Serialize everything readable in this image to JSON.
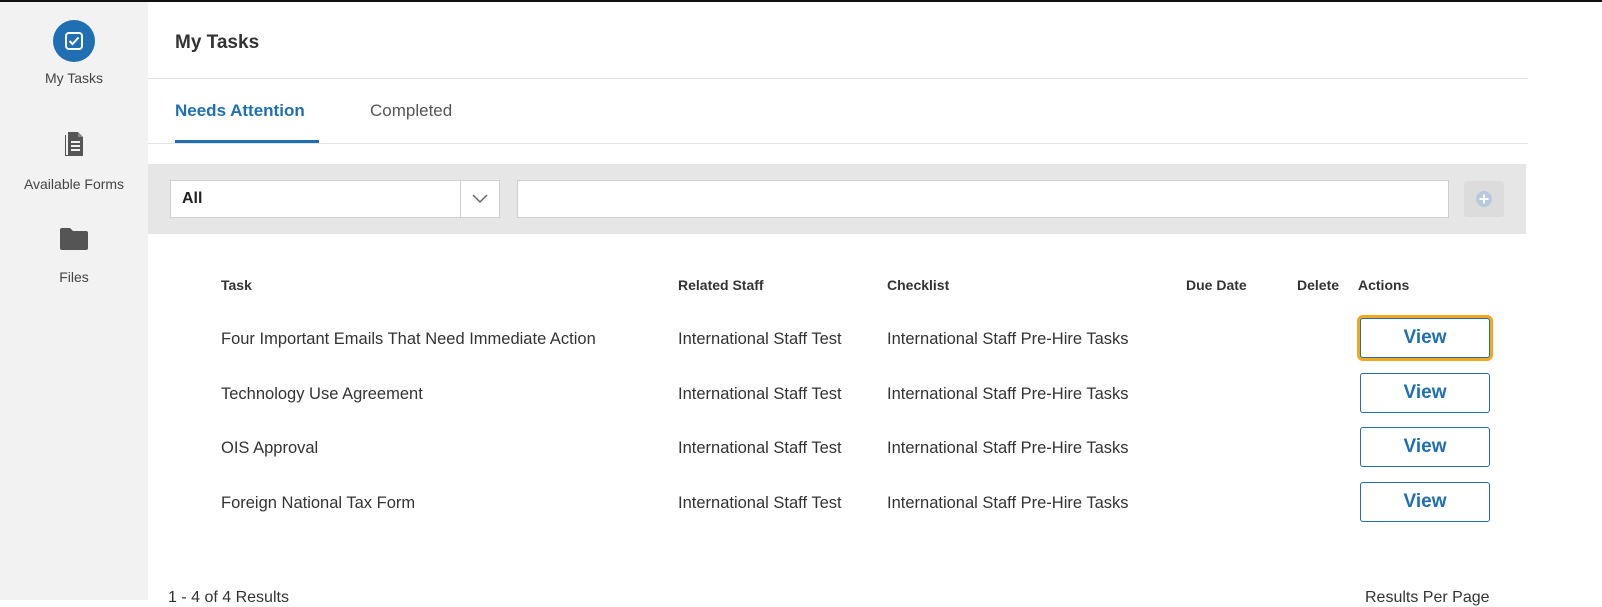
{
  "sidebar": {
    "items": [
      {
        "label": "My Tasks",
        "icon": "checkbox-icon",
        "active": true
      },
      {
        "label": "Available Forms",
        "icon": "document-icon",
        "active": false
      },
      {
        "label": "Files",
        "icon": "folder-icon",
        "active": false
      }
    ]
  },
  "page": {
    "title": "My Tasks"
  },
  "tabs": [
    {
      "label": "Needs Attention",
      "active": true
    },
    {
      "label": "Completed",
      "active": false
    }
  ],
  "filter": {
    "selected": "All",
    "search_value": "",
    "search_placeholder": ""
  },
  "table": {
    "columns": [
      "Task",
      "Related Staff",
      "Checklist",
      "Due Date",
      "Delete",
      "Actions"
    ],
    "rows": [
      {
        "task": "Four Important Emails That Need Immediate Action",
        "staff": "International Staff Test",
        "checklist": "International Staff Pre-Hire Tasks",
        "due": "",
        "action": "View"
      },
      {
        "task": "Technology Use Agreement",
        "staff": "International Staff Test",
        "checklist": "International Staff Pre-Hire Tasks",
        "due": "",
        "action": "View"
      },
      {
        "task": "OIS Approval",
        "staff": "International Staff Test",
        "checklist": "International Staff Pre-Hire Tasks",
        "due": "",
        "action": "View"
      },
      {
        "task": "Foreign National Tax Form",
        "staff": "International Staff Test",
        "checklist": "International Staff Pre-Hire Tasks",
        "due": "",
        "action": "View"
      }
    ]
  },
  "footer": {
    "results": "1 - 4 of 4 Results",
    "per_page_label": "Results Per Page"
  },
  "colors": {
    "accent": "#1f6fb2",
    "focus": "#f2a81d",
    "sidebar_bg": "#f2f2f2",
    "filter_bg": "#e6e6e6"
  }
}
